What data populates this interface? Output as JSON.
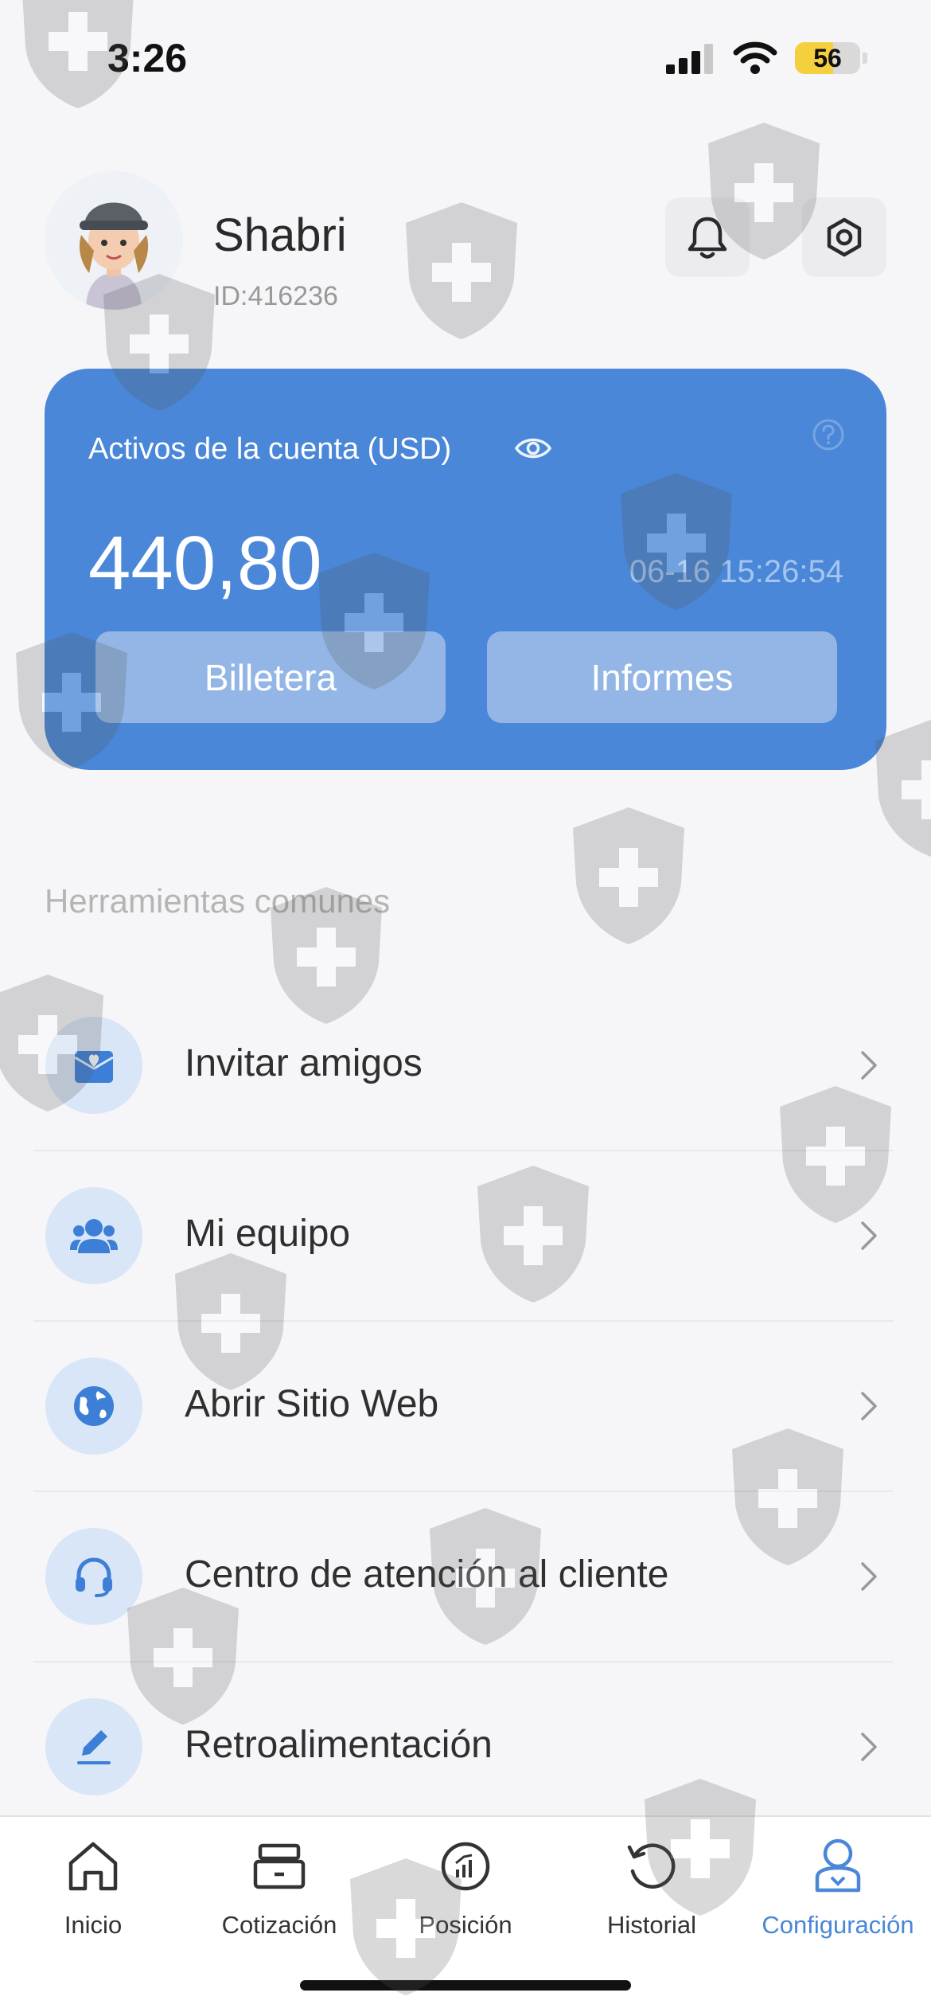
{
  "status": {
    "time": "3:26",
    "battery": "56",
    "battery_percent": 56
  },
  "profile": {
    "name": "Shabri",
    "id": "ID:416236"
  },
  "account": {
    "title": "Activos de la cuenta (USD)",
    "balance": "440,80",
    "timestamp": "06-16 15:26:54",
    "wallet_label": "Billetera",
    "reports_label": "Informes"
  },
  "tools": {
    "title": "Herramientas comunes",
    "items": [
      {
        "label": "Invitar amigos",
        "icon": "invite-envelope-icon"
      },
      {
        "label": "Mi equipo",
        "icon": "team-icon"
      },
      {
        "label": "Abrir Sitio Web",
        "icon": "globe-icon"
      },
      {
        "label": "Centro de atención al cliente",
        "icon": "headset-icon"
      },
      {
        "label": "Retroalimentación",
        "icon": "pen-icon"
      }
    ]
  },
  "tabs": [
    {
      "label": "Inicio",
      "icon": "home-icon"
    },
    {
      "label": "Cotización",
      "icon": "quote-icon"
    },
    {
      "label": "Posición",
      "icon": "position-icon"
    },
    {
      "label": "Historial",
      "icon": "history-icon"
    },
    {
      "label": "Configuración",
      "icon": "profile-icon",
      "active": true
    }
  ],
  "colors": {
    "accent": "#4a87d8",
    "card_button": "#93b6e6",
    "icon_circle": "#d9e6f7",
    "background": "#f6f6f9"
  }
}
